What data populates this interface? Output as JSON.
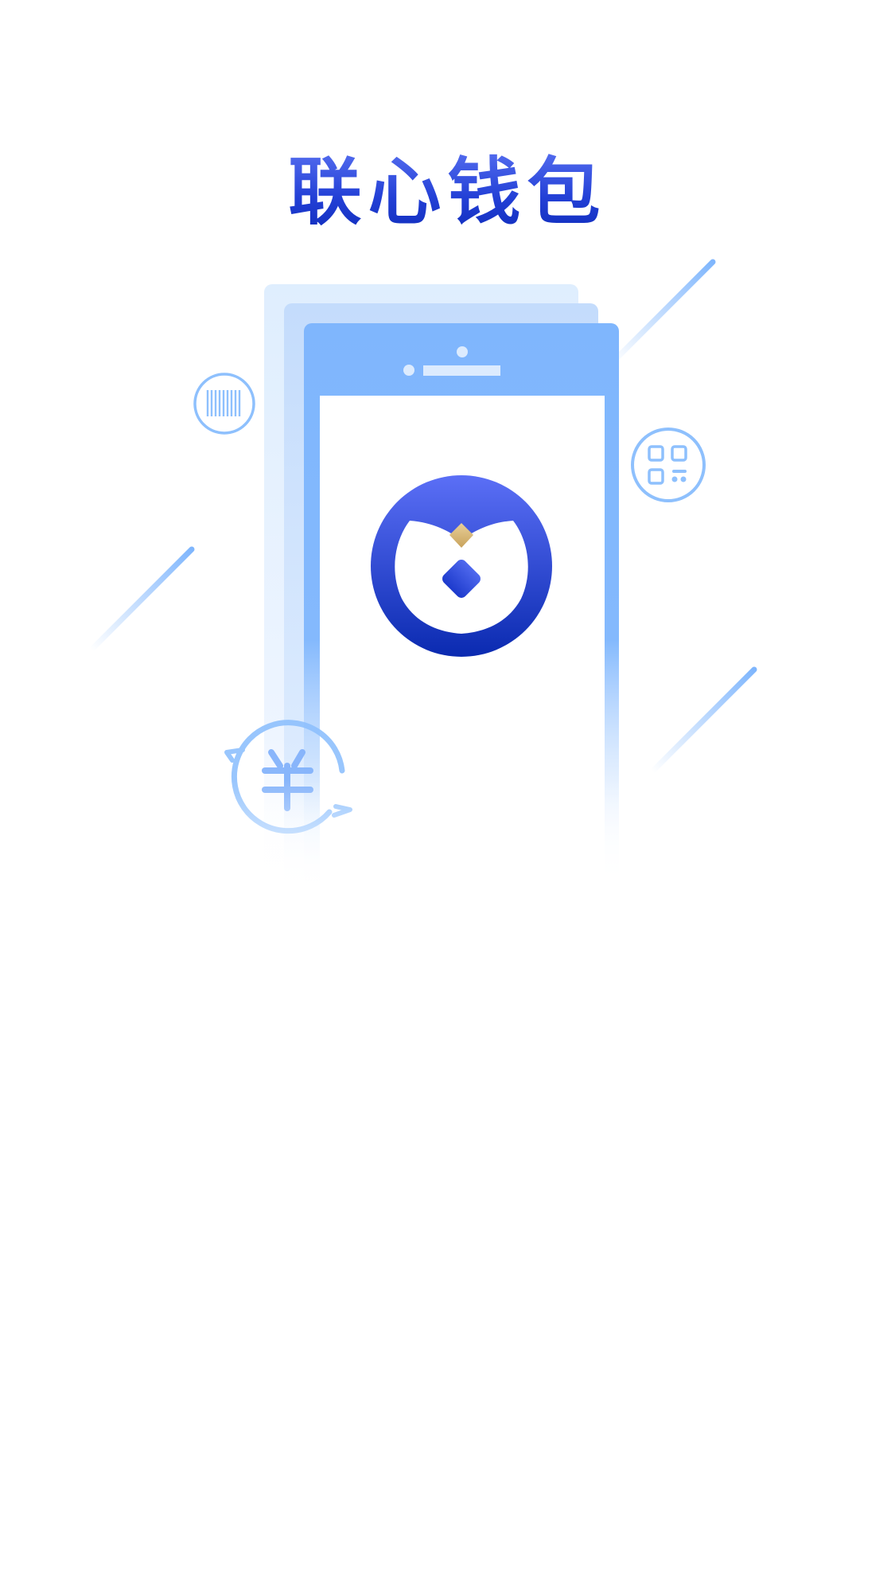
{
  "splash": {
    "title": "联心钱包"
  },
  "colors": {
    "title_gradient_top": "#5a72f2",
    "title_gradient_bottom": "#0d2ab8",
    "phone_frame": "#7fb6fd",
    "logo_gradient_top": "#5b6ff6",
    "logo_gradient_bottom": "#0a2ab0",
    "logo_gold": "#d8b776"
  },
  "icons": [
    "barcode-icon",
    "qr-code-icon",
    "yuan-exchange-icon",
    "wallet-logo-icon"
  ]
}
